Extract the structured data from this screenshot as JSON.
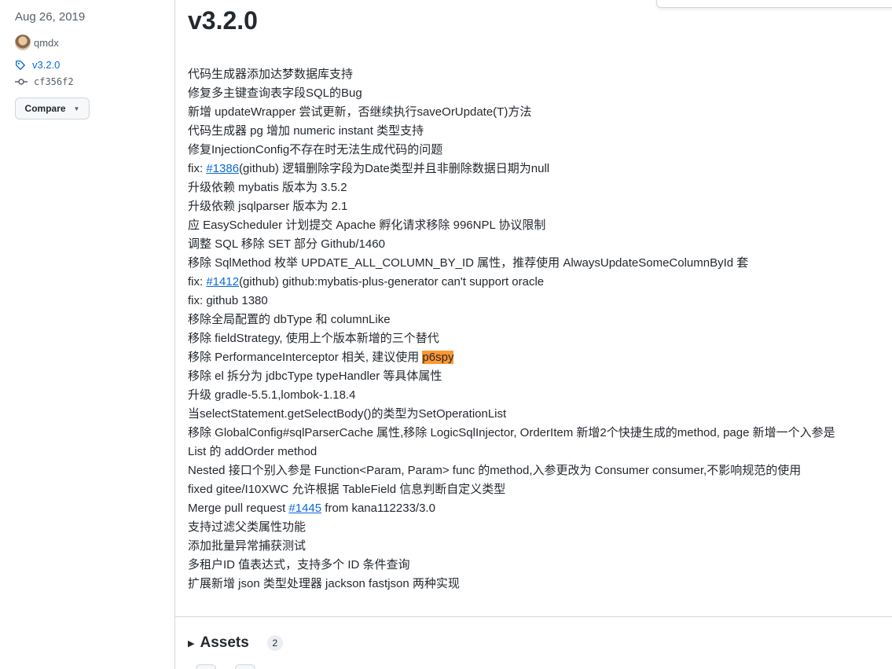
{
  "sidebar": {
    "date": "Aug 26, 2019",
    "author": "qmdx",
    "tag": "v3.2.0",
    "commit": "cf356f2",
    "compare_label": "Compare"
  },
  "release": {
    "title": "v3.2.0",
    "notes": [
      {
        "text": "代码生成器添加达梦数据库支持"
      },
      {
        "text": "修复多主键查询表字段SQL的Bug"
      },
      {
        "text": "新增 updateWrapper 尝试更新，否继续执行saveOrUpdate(T)方法"
      },
      {
        "text": "代码生成器 pg 增加 numeric instant 类型支持"
      },
      {
        "text": "修复InjectionConfig不存在时无法生成代码的问题"
      },
      {
        "pre": "fix: ",
        "link": "#1386",
        "post": "(github) 逻辑删除字段为Date类型并且非删除数据日期为null"
      },
      {
        "text": "升级依赖 mybatis 版本为 3.5.2"
      },
      {
        "text": "升级依赖 jsqlparser 版本为 2.1"
      },
      {
        "text": "应 EasyScheduler 计划提交 Apache 孵化请求移除 996NPL 协议限制"
      },
      {
        "text": "调整 SQL 移除 SET 部分 Github/1460"
      },
      {
        "text": "移除 SqlMethod 枚举 UPDATE_ALL_COLUMN_BY_ID 属性，推荐使用 AlwaysUpdateSomeColumnById 套"
      },
      {
        "pre": "fix: ",
        "link": "#1412",
        "post": "(github) github:mybatis-plus-generator can't support oracle"
      },
      {
        "text": "fix: github 1380"
      },
      {
        "text": "移除全局配置的 dbType 和 columnLike"
      },
      {
        "text": "移除 fieldStrategy, 使用上个版本新增的三个替代"
      },
      {
        "pre": "移除 PerformanceInterceptor 相关, 建议使用 ",
        "highlight": "p6spy"
      },
      {
        "text": "移除 el 拆分为 jdbcType typeHandler 等具体属性"
      },
      {
        "text": "升级 gradle-5.5.1,lombok-1.18.4"
      },
      {
        "text": "当selectStatement.getSelectBody()的类型为SetOperationList"
      },
      {
        "text": "移除 GlobalConfig#sqlParserCache 属性,移除 LogicSqlInjector, OrderItem 新增2个快捷生成的method, page 新增一个入参是"
      },
      {
        "text": "List 的 addOrder method"
      },
      {
        "text": "Nested 接口个别入参是 Function<Param, Param> func 的method,入参更改为 Consumer consumer,不影响规范的使用"
      },
      {
        "text": "fixed gitee/I10XWC 允许根据 TableField 信息判断自定义类型"
      },
      {
        "pre": "Merge pull request ",
        "link": "#1445",
        "post": " from kana112233/3.0"
      },
      {
        "text": "支持过滤父类属性功能"
      },
      {
        "text": "添加批量异常捕获测试"
      },
      {
        "text": "多租户ID 值表达式，支持多个 ID 条件查询"
      },
      {
        "text": "扩展新增 json 类型处理器 jackson fastjson 两种实现"
      }
    ]
  },
  "assets": {
    "label": "Assets",
    "count": "2"
  },
  "colors": {
    "link": "#0969da",
    "highlight": "#ff9632",
    "border": "#d0d7de",
    "muted": "#57606a"
  }
}
